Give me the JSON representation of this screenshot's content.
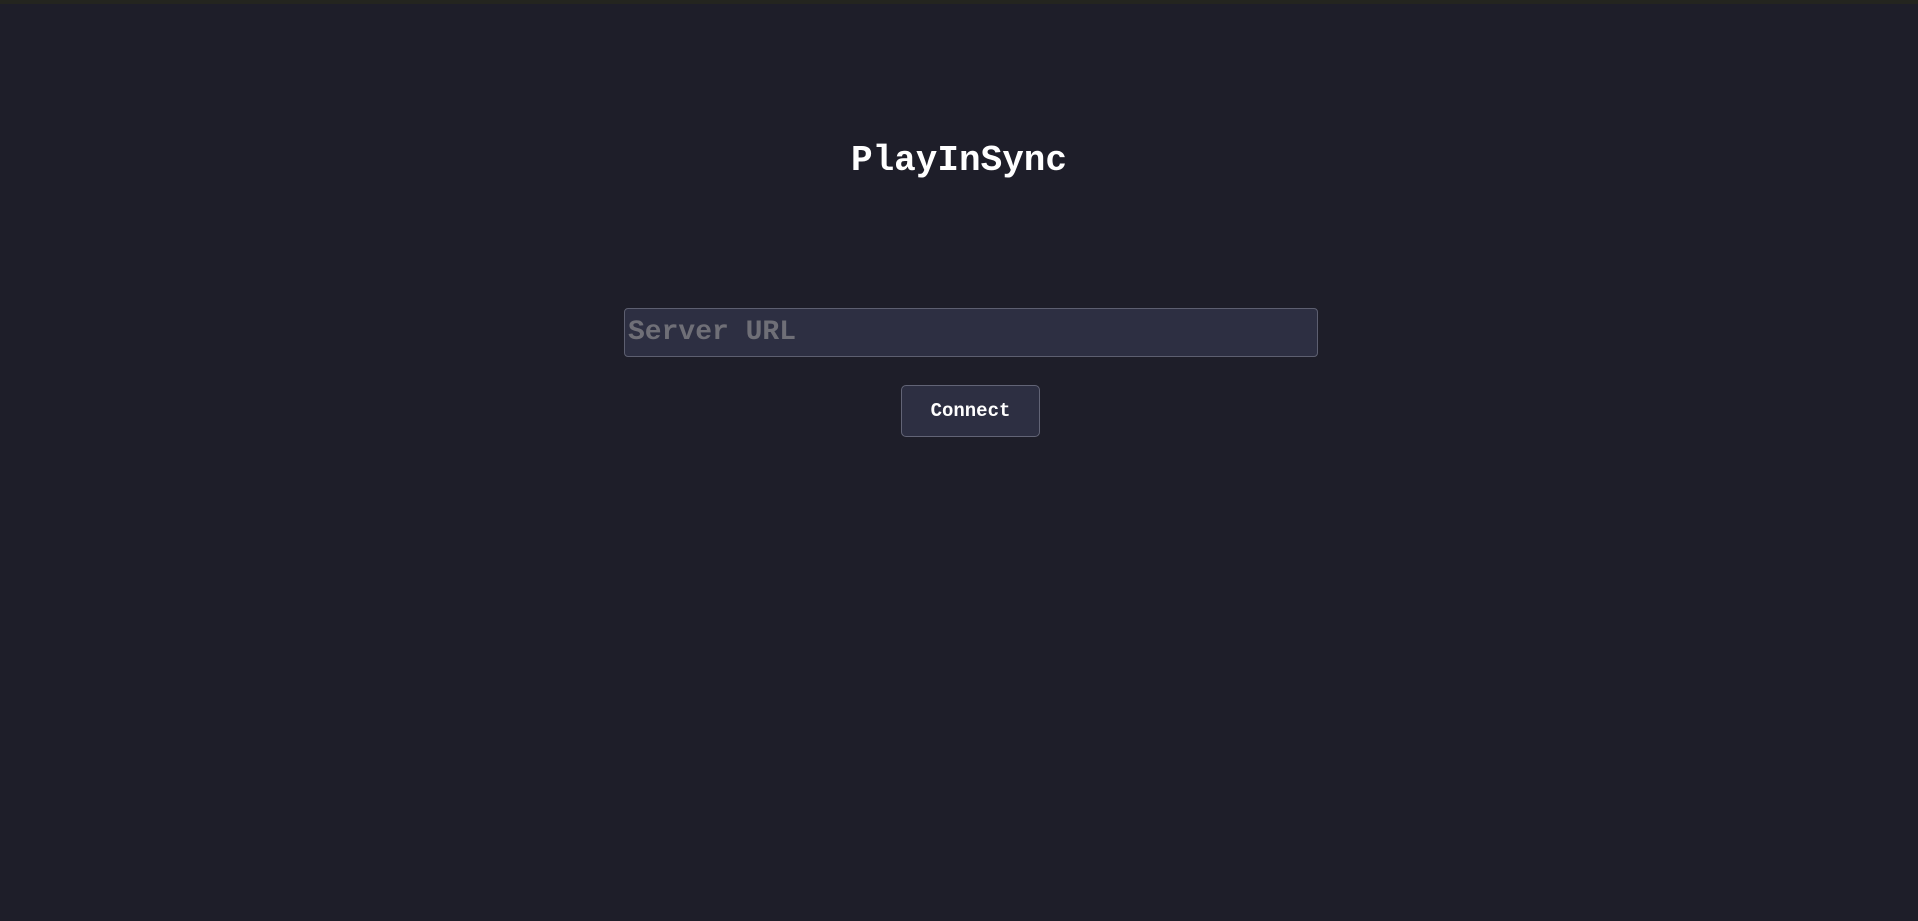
{
  "app": {
    "title": "PlayInSync"
  },
  "connection_form": {
    "server_url": {
      "value": "",
      "placeholder": "Server URL"
    },
    "connect_label": "Connect"
  },
  "colors": {
    "background": "#1e1e29",
    "control_background": "#2d2f42",
    "control_border": "#5d5f70",
    "title_text": "#ffffff",
    "placeholder_text": "#6f6f77"
  }
}
